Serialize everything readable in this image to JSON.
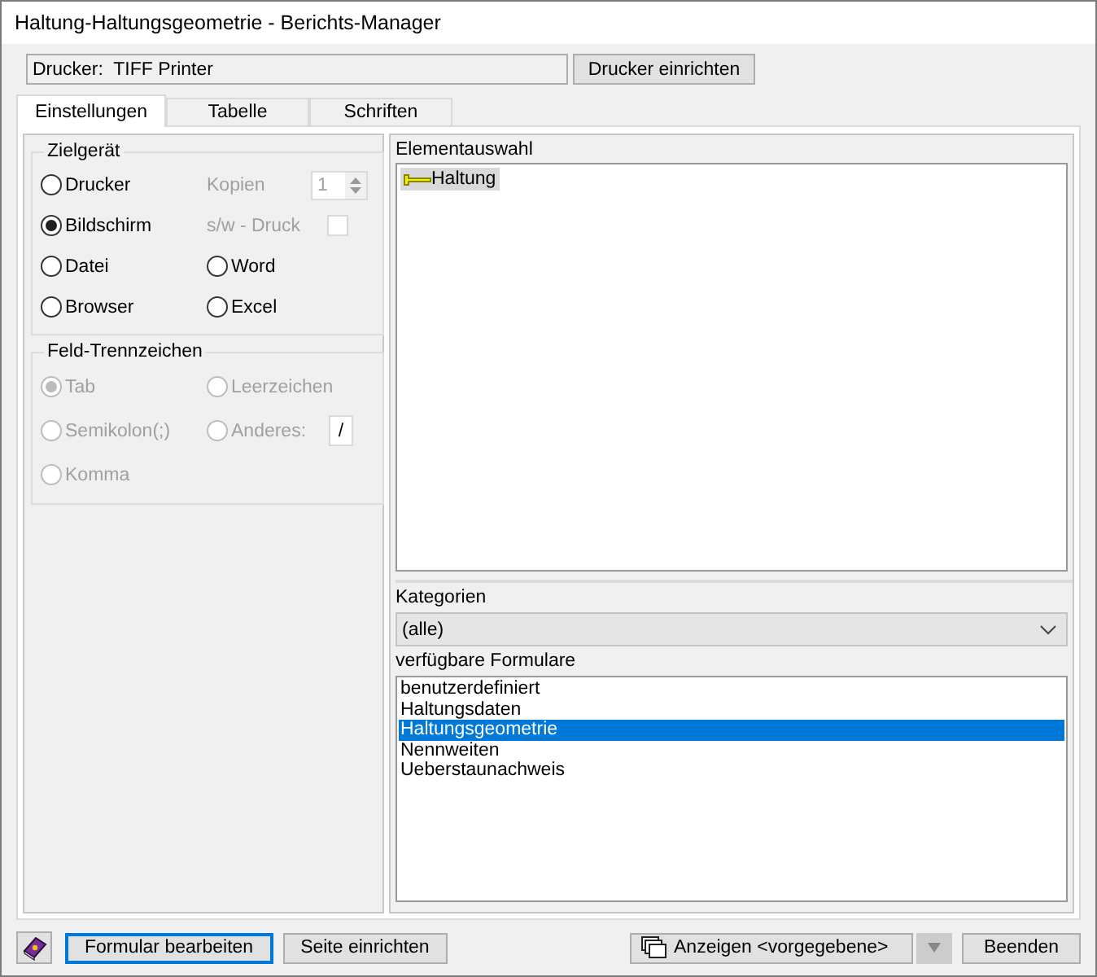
{
  "window": {
    "title": "Haltung-Haltungsgeometrie - Berichts-Manager"
  },
  "printer": {
    "value": "Drucker:  TIFF Printer",
    "button": "Drucker einrichten"
  },
  "tabs": [
    {
      "label": "Einstellungen",
      "selected": true
    },
    {
      "label": "Tabelle",
      "selected": false
    },
    {
      "label": "Schriften",
      "selected": false
    }
  ],
  "zielgeraet": {
    "title": "Zielgerät",
    "rows": [
      [
        {
          "kind": "radio",
          "label": "Drucker",
          "selected": false,
          "disabled": false
        },
        {
          "kind": "spinner",
          "label": "Kopien",
          "value": "1",
          "disabled": true
        }
      ],
      [
        {
          "kind": "radio",
          "label": "Bildschirm",
          "selected": true,
          "disabled": false
        },
        {
          "kind": "checkbox",
          "label": "s/w - Druck",
          "checked": false,
          "disabled": true
        }
      ],
      [
        {
          "kind": "radio",
          "label": "Datei",
          "selected": false,
          "disabled": false
        },
        {
          "kind": "radio",
          "label": "Word",
          "selected": false,
          "disabled": false
        }
      ],
      [
        {
          "kind": "radio",
          "label": "Browser",
          "selected": false,
          "disabled": false
        },
        {
          "kind": "radio",
          "label": "Excel",
          "selected": false,
          "disabled": false
        }
      ]
    ]
  },
  "trennzeichen": {
    "title": "Feld-Trennzeichen",
    "rows": [
      [
        {
          "kind": "radio",
          "label": "Tab",
          "selected": true,
          "disabled": true
        },
        {
          "kind": "radio",
          "label": "Leerzeichen",
          "selected": false,
          "disabled": true
        }
      ],
      [
        {
          "kind": "radio",
          "label": "Semikolon(;)",
          "selected": false,
          "disabled": true
        },
        {
          "kind": "radio-field",
          "label": "Anderes:",
          "selected": false,
          "disabled": true,
          "value": "/"
        }
      ],
      [
        {
          "kind": "radio",
          "label": "Komma",
          "selected": false,
          "disabled": true
        }
      ]
    ]
  },
  "elementauswahl": {
    "title": "Elementauswahl",
    "items": [
      {
        "label": "Haltung",
        "selected": true
      }
    ]
  },
  "kategorien": {
    "label": "Kategorien",
    "value": "(alle)"
  },
  "formulare": {
    "label": "verfügbare Formulare",
    "items": [
      {
        "label": "benutzerdefiniert",
        "selected": false
      },
      {
        "label": "Haltungsdaten",
        "selected": false
      },
      {
        "label": "Haltungsgeometrie",
        "selected": true
      },
      {
        "label": "Nennweiten",
        "selected": false
      },
      {
        "label": "Ueberstaunachweis",
        "selected": false
      }
    ]
  },
  "buttons": {
    "edit": "Formular bearbeiten",
    "page": "Seite einrichten",
    "show": "Anzeigen <vorgegebene>",
    "close": "Beenden"
  }
}
